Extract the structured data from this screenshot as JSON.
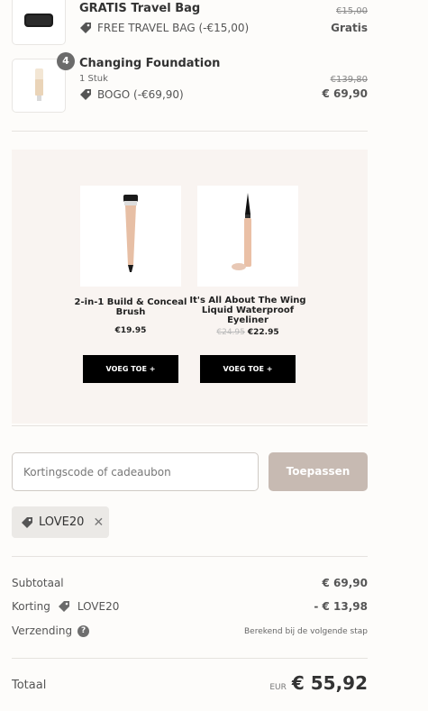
{
  "items": [
    {
      "name": "GRATIS Travel Bag",
      "discount": "FREE TRAVEL BAG (-€15,00)",
      "price_old": "€15,00",
      "price_new": "Gratis",
      "quantity": ""
    },
    {
      "name": "Changing Foundation",
      "sub": "1 Stuk",
      "discount": "BOGO (-€69,90)",
      "price_old": "€139,80",
      "price_new": "€ 69,90",
      "quantity": "4"
    }
  ],
  "upsell": {
    "products": [
      {
        "name": "2-in-1 Build & Conceal Brush",
        "price": "€19.95",
        "old_price": "",
        "button": "VOEG TOE +"
      },
      {
        "name": "It's All About The Wing Liquid Waterproof Eyeliner",
        "price": "€22.95",
        "old_price": "€24.95",
        "button": "VOEG TOE +"
      }
    ]
  },
  "discount": {
    "placeholder": "Kortingscode of cadeaubon",
    "apply_label": "Toepassen",
    "applied_code": "LOVE20"
  },
  "summary": {
    "subtotal_label": "Subtotaal",
    "subtotal_value": "€ 69,90",
    "korting_label": "Korting",
    "korting_code": "LOVE20",
    "korting_value": "- € 13,98",
    "shipping_label": "Verzending",
    "shipping_note": "Berekend bij de volgende stap",
    "total_label": "Totaal",
    "currency": "EUR",
    "total_value": "€ 55,92"
  },
  "colors": {
    "accent_button": "#c7bab2",
    "upsell_bg": "#f9f4f1",
    "cta_black": "#000000"
  }
}
